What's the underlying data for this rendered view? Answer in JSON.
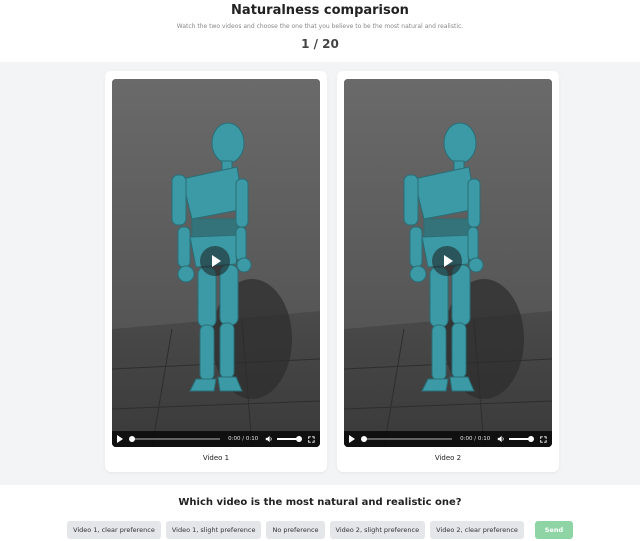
{
  "header": {
    "title": "Naturalness comparison",
    "subtitle": "Watch the two videos and choose the one that you believe to be the most natural and realistic.",
    "counter": "1 / 20"
  },
  "videos": [
    {
      "label": "Video 1",
      "time": "0:00 / 0:10",
      "progress": 0.0,
      "volume": 1.0
    },
    {
      "label": "Video 2",
      "time": "0:00 / 0:10",
      "progress": 0.0,
      "volume": 1.0
    }
  ],
  "question": "Which video is the most natural and realistic one?",
  "choices": [
    "Video 1, clear preference",
    "Video 1, slight preference",
    "No preference",
    "Video 2, slight preference",
    "Video 2, clear preference"
  ],
  "send_label": "Send",
  "colors": {
    "stage_bg": "#f3f4f5",
    "figure": "#3b9aa5",
    "send_button": "#8fd4a4",
    "choice_button": "#e4e6ea"
  },
  "icons": [
    "play-icon",
    "volume-icon",
    "fullscreen-icon"
  ]
}
